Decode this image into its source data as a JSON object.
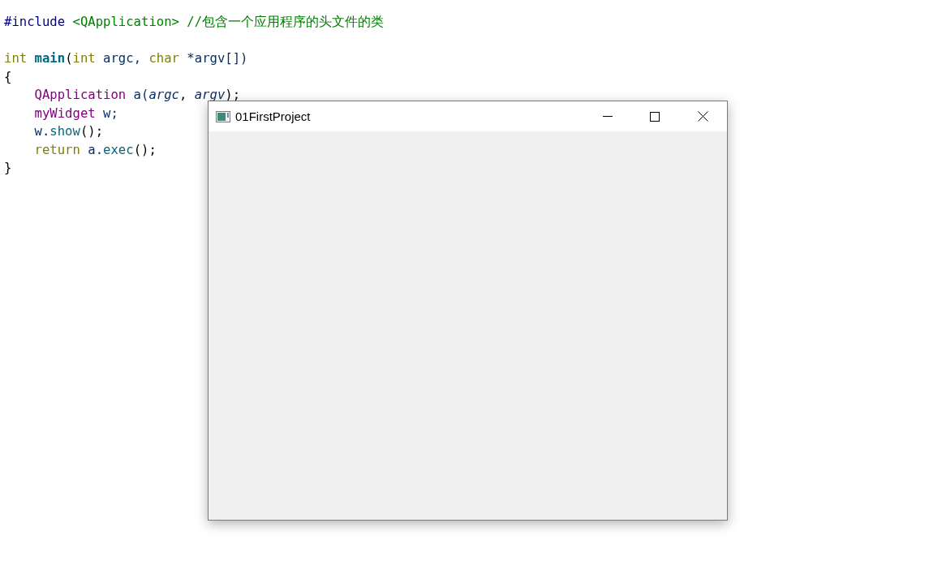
{
  "code_lines": [
    {
      "kind": "code",
      "indented": false,
      "tokens": [
        {
          "text": "#include ",
          "kind": "preprocessor"
        },
        {
          "text": "<QApplication> ",
          "kind": "string"
        },
        {
          "text": "//包含一个应用程序的头文件的类",
          "kind": "comment"
        }
      ]
    },
    {
      "kind": "blank"
    },
    {
      "kind": "code",
      "indented": false,
      "tokens": [
        {
          "text": "int ",
          "kind": "keyword"
        },
        {
          "text": "main",
          "kind": "function"
        },
        {
          "text": "(",
          "kind": "plain"
        },
        {
          "text": "int",
          "kind": "keyword"
        },
        {
          "text": " argc, ",
          "kind": "variable"
        },
        {
          "text": "char",
          "kind": "keyword"
        },
        {
          "text": " *argv[])",
          "kind": "variable"
        }
      ]
    },
    {
      "kind": "code",
      "indented": false,
      "tokens": [
        {
          "text": "{",
          "kind": "plain"
        }
      ]
    },
    {
      "kind": "code",
      "indented": true,
      "tokens": [
        {
          "text": "QApplication",
          "kind": "type"
        },
        {
          "text": " a(",
          "kind": "variable"
        },
        {
          "text": "argc",
          "kind": "parameter"
        },
        {
          "text": ", ",
          "kind": "plain"
        },
        {
          "text": "argv",
          "kind": "parameter"
        },
        {
          "text": ");",
          "kind": "plain"
        }
      ]
    },
    {
      "kind": "code",
      "indented": true,
      "tokens": [
        {
          "text": "myWidget",
          "kind": "type"
        },
        {
          "text": " w;",
          "kind": "variable"
        }
      ]
    },
    {
      "kind": "code",
      "indented": true,
      "tokens": [
        {
          "text": "w.",
          "kind": "variable"
        },
        {
          "text": "show",
          "kind": "method"
        },
        {
          "text": "();",
          "kind": "plain"
        }
      ]
    },
    {
      "kind": "code",
      "indented": true,
      "tokens": [
        {
          "text": "return",
          "kind": "keyword"
        },
        {
          "text": " a.",
          "kind": "variable"
        },
        {
          "text": "exec",
          "kind": "method"
        },
        {
          "text": "();",
          "kind": "plain"
        }
      ]
    },
    {
      "kind": "code",
      "indented": false,
      "tokens": [
        {
          "text": "}",
          "kind": "plain"
        }
      ]
    }
  ],
  "app_window": {
    "title": "01FirstProject"
  }
}
